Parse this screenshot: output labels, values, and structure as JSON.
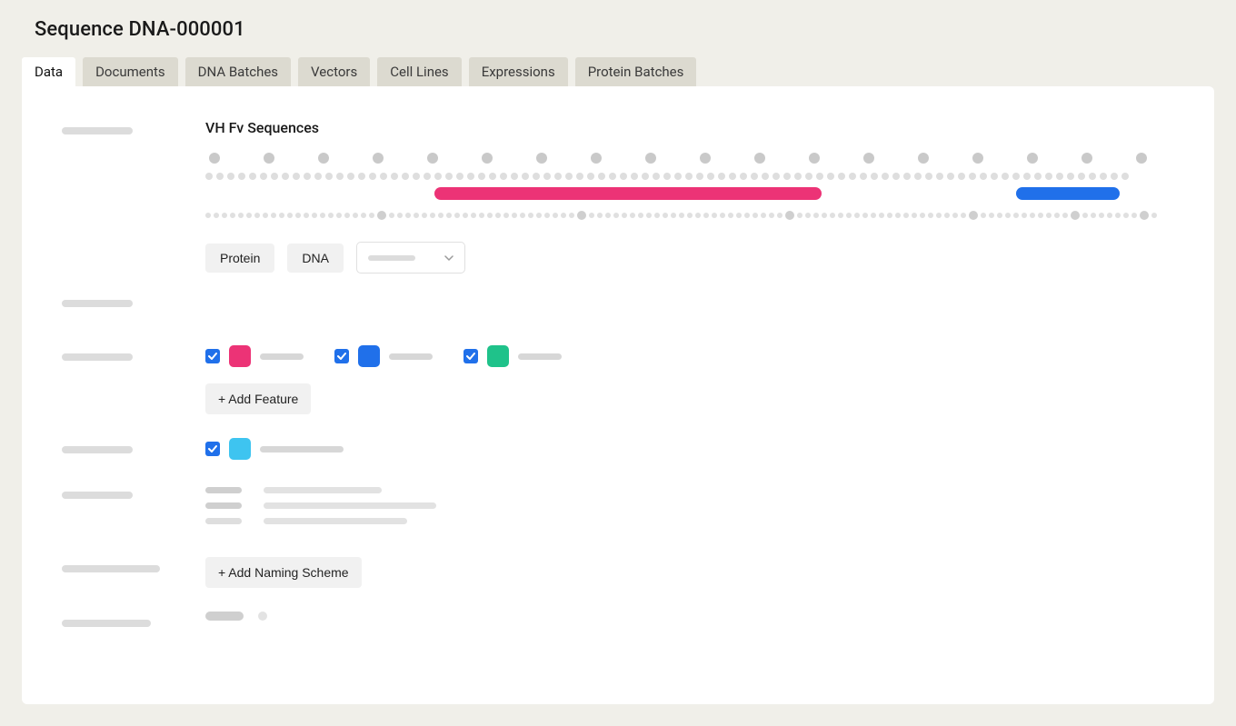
{
  "header": {
    "title": "Sequence DNA-000001"
  },
  "tabs": [
    {
      "label": "Data",
      "active": true
    },
    {
      "label": "Documents",
      "active": false
    },
    {
      "label": "DNA Batches",
      "active": false
    },
    {
      "label": "Vectors",
      "active": false
    },
    {
      "label": "Cell Lines",
      "active": false
    },
    {
      "label": "Expressions",
      "active": false
    },
    {
      "label": "Protein Batches",
      "active": false
    }
  ],
  "section": {
    "heading": "VH Fv Sequences"
  },
  "seq_buttons": {
    "protein": "Protein",
    "dna": "DNA"
  },
  "actions": {
    "add_feature": "+ Add Feature",
    "add_naming_scheme": "+ Add Naming Scheme"
  },
  "features": [
    {
      "color": "pink",
      "checked": true
    },
    {
      "color": "blue",
      "checked": true
    },
    {
      "color": "green",
      "checked": true
    }
  ],
  "annotations": [
    {
      "color": "cyan",
      "checked": true
    }
  ]
}
